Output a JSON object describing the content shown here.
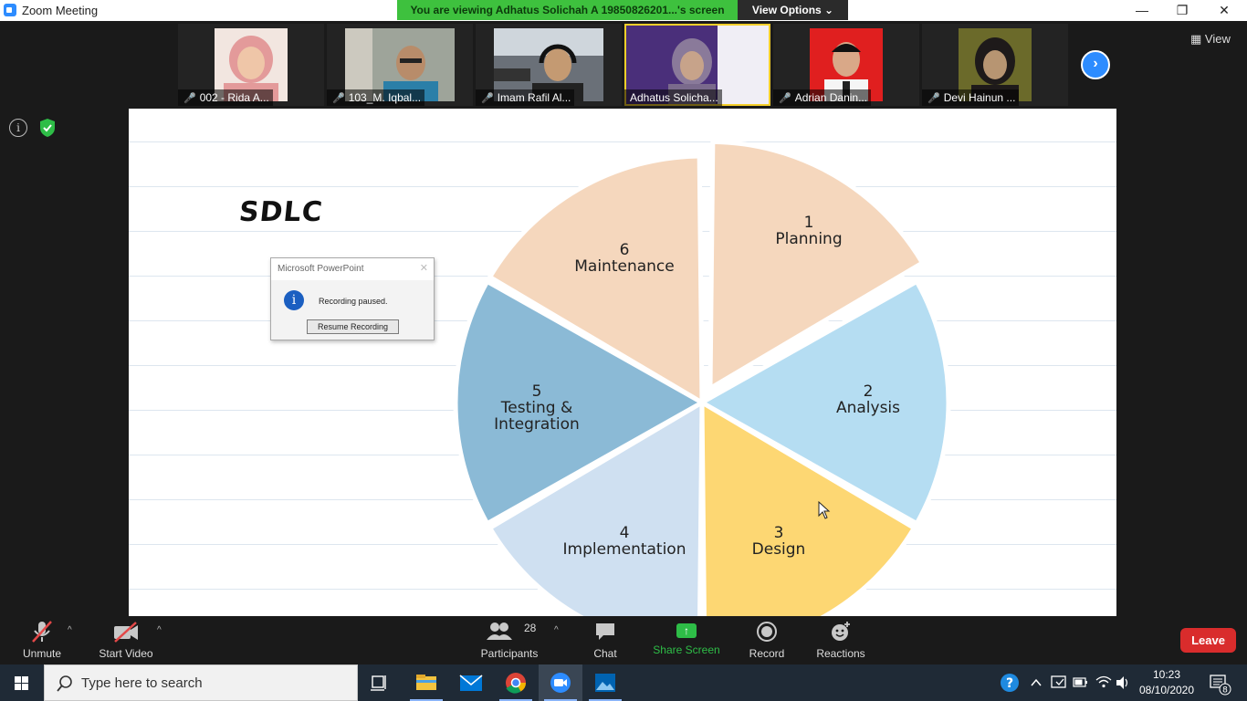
{
  "window": {
    "title": "Zoom Meeting",
    "share_banner": "You are viewing Adhatus Solichah A 19850826201...'s screen",
    "view_options": "View Options ⌄",
    "minimize": "—",
    "restore": "❐",
    "close": "✕"
  },
  "participants_strip": [
    {
      "name": "002 - Rida A...",
      "face_color": "#e8b8b0",
      "bg": "#f2e6e0"
    },
    {
      "name": "103_M. Iqbal...",
      "face_color": "#b88c6a",
      "bg": "#9ea49a"
    },
    {
      "name": "Imam Rafil Al...",
      "face_color": "#c49a72",
      "bg": "#6a7078"
    },
    {
      "name": "Adhatus Solicha...",
      "face_color": "#c7a38a",
      "bg": "#4a2f7a",
      "active": true
    },
    {
      "name": "Adrian Danin...",
      "face_color": "#d9a888",
      "bg": "#e01f1f"
    },
    {
      "name": "Devi Hainun ...",
      "face_color": "#b79572",
      "bg": "#6b6a2a"
    }
  ],
  "strip_view_label": "View",
  "next_page": "›",
  "info_glyph": "i",
  "slide": {
    "title": "SDLC",
    "segments": [
      {
        "number": "1",
        "label": "Planning",
        "color": "#f5d7bd"
      },
      {
        "number": "2",
        "label": "Analysis",
        "color": "#b5ddf2"
      },
      {
        "number": "3",
        "label": "Design",
        "color": "#fdd773"
      },
      {
        "number": "4",
        "label": "Implementation",
        "color": "#cfe0f1"
      },
      {
        "number": "5",
        "label": "Testing & Integration",
        "label_line1": "Testing &",
        "label_line2": "Integration",
        "color": "#8bbad6"
      },
      {
        "number": "6",
        "label": "Maintenance",
        "color": "#f5d7bd"
      }
    ]
  },
  "dialog": {
    "title": "Microsoft PowerPoint",
    "close": "✕",
    "info_glyph": "i",
    "message": "Recording paused.",
    "button": "Resume Recording"
  },
  "controls": {
    "unmute": "Unmute",
    "start_video": "Start Video",
    "participants": "Participants",
    "participant_count": "28",
    "chat": "Chat",
    "share_screen": "Share Screen",
    "record": "Record",
    "reactions": "Reactions",
    "leave": "Leave",
    "caret": "^"
  },
  "taskbar": {
    "search_placeholder": "Type here to search",
    "time": "10:23",
    "date": "08/10/2020",
    "notification_count": "8",
    "help": "?"
  },
  "colors": {
    "share_banner": "#3ec13e",
    "share_screen_icon": "#2ebd47",
    "leave": "#d92c2c",
    "zoom_blue": "#2d8cff",
    "active_speaker": "#f5cf2a"
  }
}
